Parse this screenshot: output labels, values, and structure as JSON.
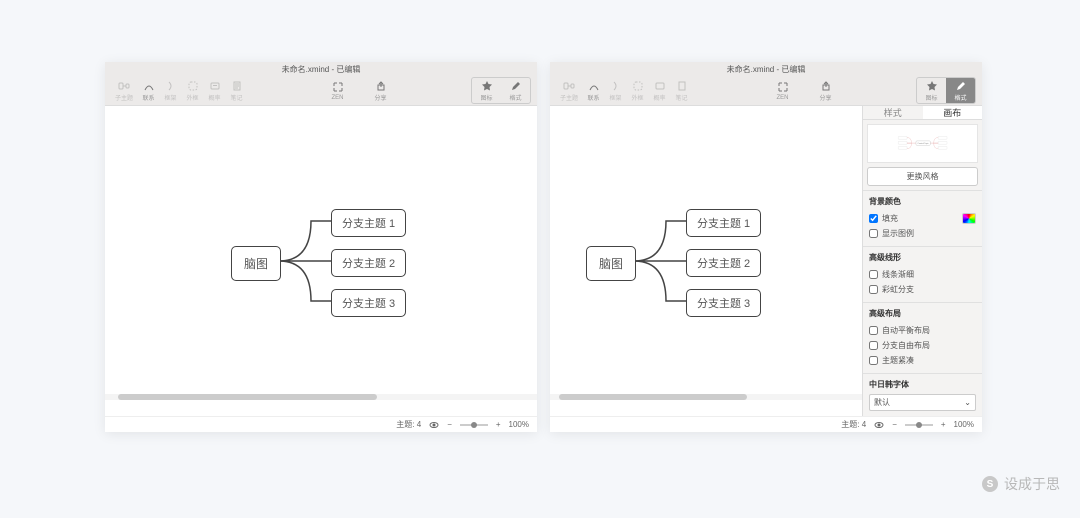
{
  "title": "未命名.xmind - 已编辑",
  "toolbar": {
    "left": [
      "子主题",
      "联系",
      "框架",
      "外框",
      "概率",
      "笔记"
    ],
    "center_zen": "ZEN",
    "center_share": "分享",
    "right_icon": "图标",
    "right_format": "格式"
  },
  "mindmap": {
    "root": "脑图",
    "branches": [
      "分支主题 1",
      "分支主题 2",
      "分支主题 3"
    ]
  },
  "statusbar": {
    "topics_label": "主题:",
    "topics_count": "4",
    "zoom": "100%"
  },
  "panel": {
    "tab_style": "样式",
    "tab_canvas": "画布",
    "change_style": "更换风格",
    "bg_title": "背景颜色",
    "fill": "填充",
    "show_legend": "显示图例",
    "adv_lines_title": "高级线形",
    "line_thin": "线条渐细",
    "rainbow": "彩虹分支",
    "adv_layout_title": "高级布局",
    "auto_balance": "自动平衡布局",
    "free_branch": "分支自由布局",
    "topic_fold": "主题紧凑",
    "cjk_title": "中日韩字体",
    "default": "默认"
  },
  "brand": "设成于思"
}
